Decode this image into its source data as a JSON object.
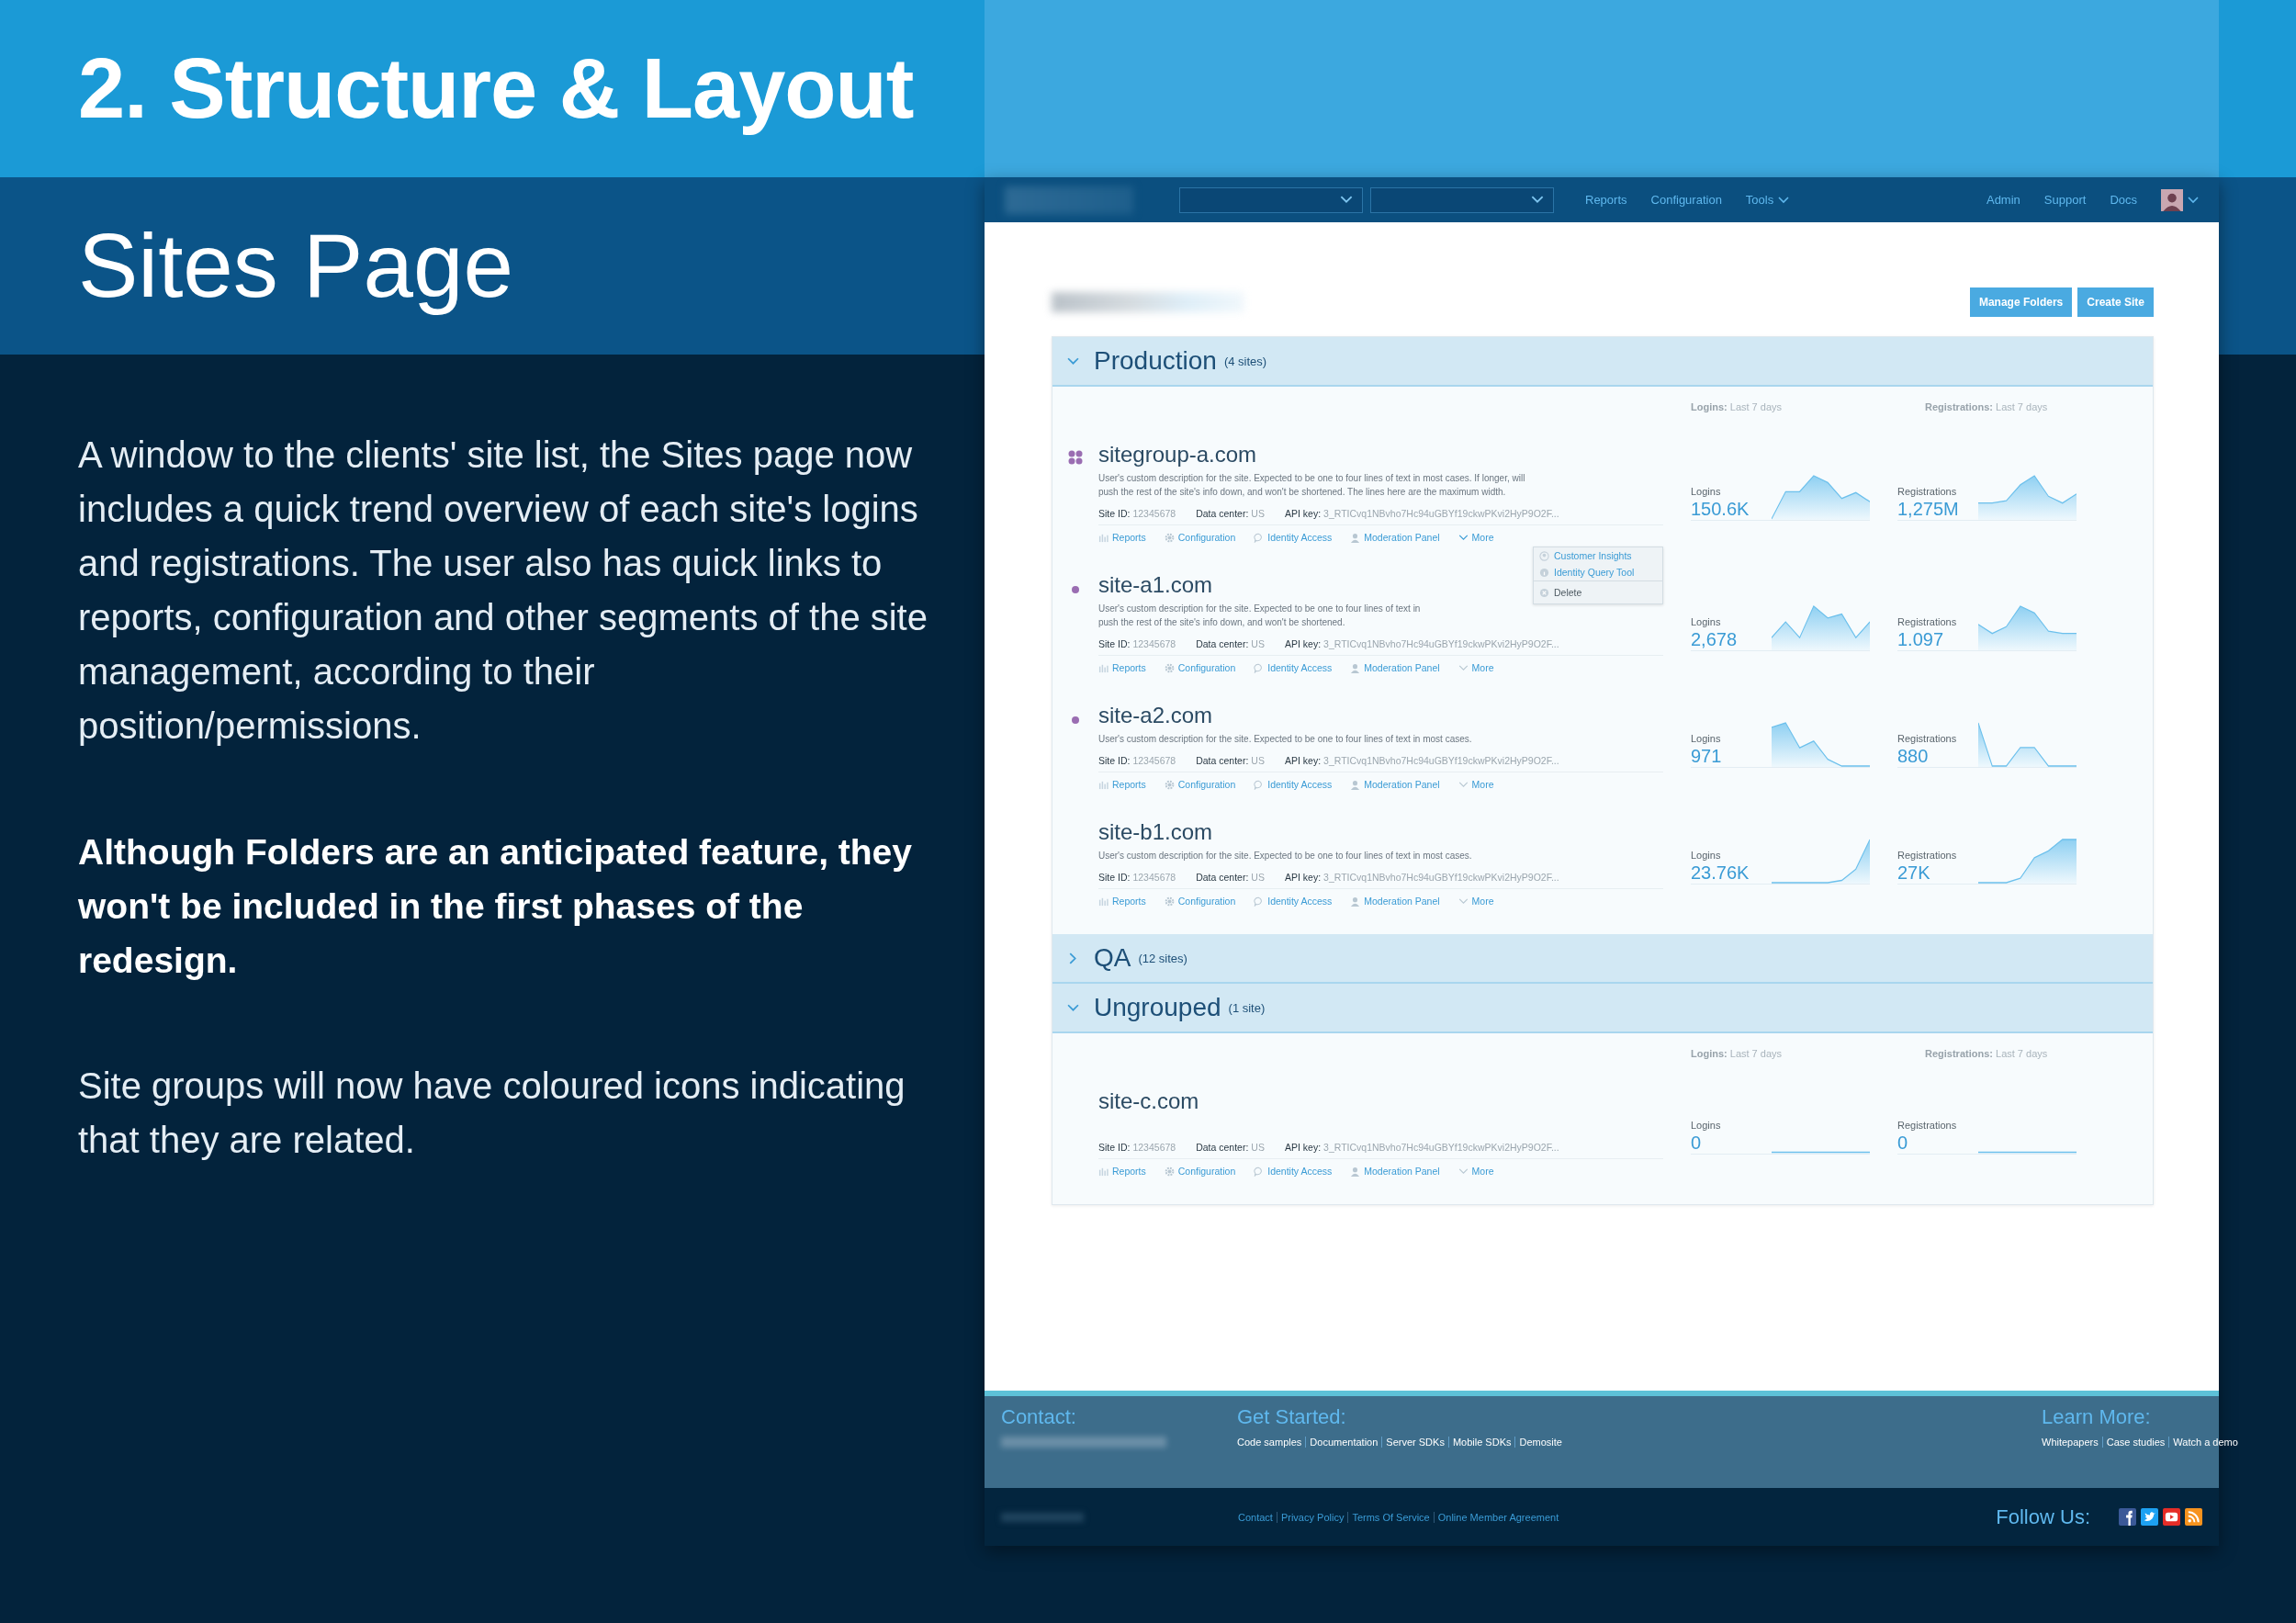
{
  "slide": {
    "title": "2. Structure & Layout",
    "subtitle": "Sites Page",
    "paragraphs": [
      {
        "text": "A window to the clients' site list, the Sites page now includes a quick trend overview of each site's logins and registrations. The user also has quick links to reports, configuration and other segments of the site management, according to their position/permissions.",
        "bold": false
      },
      {
        "text": "Although Folders are an anticipated feature, they won't be included in the first phases of the redesign.",
        "bold": true
      },
      {
        "text": "Site groups will now have coloured icons indicating that they are related.",
        "bold": false
      }
    ]
  },
  "screen": {
    "nav": {
      "links": [
        {
          "label": "Reports",
          "dropdown": false
        },
        {
          "label": "Configuration",
          "dropdown": false
        },
        {
          "label": "Tools",
          "dropdown": true
        }
      ],
      "right_links": [
        "Admin",
        "Support",
        "Docs"
      ]
    },
    "buttons": [
      "Manage Folders",
      "Create Site"
    ],
    "groups": [
      {
        "name": "Production",
        "count": "(4 sites)",
        "expanded": true,
        "metric_headers": [
          "**Logins:** Last 7 days",
          "**Registrations:** Last 7 days"
        ],
        "sites": [
          {
            "name": "sitegroup-a.com",
            "kind": "group",
            "color": "#9a6db2",
            "description_lines": [
              "User's custom description for the site. Expected to be one to four lines of text in most cases. If longer, will",
              "push the rest of the site's info down, and won't be shortened. The lines here are the maximum width."
            ],
            "fields": [
              {
                "label": "Site ID:",
                "value": "12345678"
              },
              {
                "label": "Data center:",
                "value": "US"
              },
              {
                "label": "API key:",
                "value": "3_RTICvq1NBvho7Hc94uGBYf19ckwPKvi2HyP9O2F..."
              }
            ],
            "links": [
              {
                "label": "Reports",
                "kind": "reports"
              },
              {
                "label": "Configuration",
                "kind": "configuration"
              },
              {
                "label": "Identity Access",
                "kind": "identity"
              },
              {
                "label": "Moderation Panel",
                "kind": "moderation"
              },
              {
                "label": "More",
                "kind": "more"
              }
            ],
            "more_menu": [
              {
                "label": "Customer Insights",
                "kind": "insights"
              },
              {
                "label": "Identity Query Tool",
                "kind": "info"
              },
              {
                "label": "Delete",
                "kind": "delete"
              }
            ],
            "metrics": [
              {
                "label": "Logins",
                "value": "150.6K"
              },
              {
                "label": "Registrations",
                "value": "1,275M"
              }
            ]
          },
          {
            "name": "site-a1.com",
            "kind": "member",
            "color": "#9a6db2",
            "description_lines": [
              "User's custom description for the site. Expected to be one to four lines of text in",
              "push the rest of the site's info down, and won't be shortened."
            ],
            "fields": [
              {
                "label": "Site ID:",
                "value": "12345678"
              },
              {
                "label": "Data center:",
                "value": "US"
              },
              {
                "label": "API key:",
                "value": "3_RTICvq1NBvho7Hc94uGBYf19ckwPKvi2HyP9O2F..."
              }
            ],
            "links": [
              {
                "label": "Reports",
                "kind": "reports"
              },
              {
                "label": "Configuration",
                "kind": "configuration"
              },
              {
                "label": "Identity Access",
                "kind": "identity"
              },
              {
                "label": "Moderation Panel",
                "kind": "moderation"
              },
              {
                "label": "More",
                "kind": "more"
              }
            ],
            "metrics": [
              {
                "label": "Logins",
                "value": "2,678"
              },
              {
                "label": "Registrations",
                "value": "1.097"
              }
            ]
          },
          {
            "name": "site-a2.com",
            "kind": "member",
            "color": "#9a6db2",
            "description_lines": [
              "User's custom description for the site. Expected to be one to four lines of text in most cases."
            ],
            "fields": [
              {
                "label": "Site ID:",
                "value": "12345678"
              },
              {
                "label": "Data center:",
                "value": "US"
              },
              {
                "label": "API key:",
                "value": "3_RTICvq1NBvho7Hc94uGBYf19ckwPKvi2HyP9O2F..."
              }
            ],
            "links": [
              {
                "label": "Reports",
                "kind": "reports"
              },
              {
                "label": "Configuration",
                "kind": "configuration"
              },
              {
                "label": "Identity Access",
                "kind": "identity"
              },
              {
                "label": "Moderation Panel",
                "kind": "moderation"
              },
              {
                "label": "More",
                "kind": "more"
              }
            ],
            "metrics": [
              {
                "label": "Logins",
                "value": "971"
              },
              {
                "label": "Registrations",
                "value": "880"
              }
            ]
          },
          {
            "name": "site-b1.com",
            "kind": "plain",
            "description_lines": [
              "User's custom description for the site. Expected to be one to four lines of text in most cases."
            ],
            "fields": [
              {
                "label": "Site ID:",
                "value": "12345678"
              },
              {
                "label": "Data center:",
                "value": "US"
              },
              {
                "label": "API key:",
                "value": "3_RTICvq1NBvho7Hc94uGBYf19ckwPKvi2HyP9O2F..."
              }
            ],
            "links": [
              {
                "label": "Reports",
                "kind": "reports"
              },
              {
                "label": "Configuration",
                "kind": "configuration"
              },
              {
                "label": "Identity Access",
                "kind": "identity"
              },
              {
                "label": "Moderation Panel",
                "kind": "moderation"
              },
              {
                "label": "More",
                "kind": "more"
              }
            ],
            "metrics": [
              {
                "label": "Logins",
                "value": "23.76K"
              },
              {
                "label": "Registrations",
                "value": "27K"
              }
            ]
          }
        ]
      },
      {
        "name": "QA",
        "count": "(12 sites)",
        "expanded": false
      },
      {
        "name": "Ungrouped",
        "count": "(1 site)",
        "expanded": true,
        "metric_headers": [
          "**Logins:** Last 7 days",
          "**Registrations:** Last 7 days"
        ],
        "sites": [
          {
            "name": "site-c.com",
            "kind": "plain",
            "fields": [
              {
                "label": "Site ID:",
                "value": "12345678"
              },
              {
                "label": "Data center:",
                "value": "US"
              },
              {
                "label": "API key:",
                "value": "3_RTICvq1NBvho7Hc94uGBYf19ckwPKvi2HyP9O2F..."
              }
            ],
            "links": [
              {
                "label": "Reports",
                "kind": "reports"
              },
              {
                "label": "Configuration",
                "kind": "configuration"
              },
              {
                "label": "Identity Access",
                "kind": "identity"
              },
              {
                "label": "Moderation Panel",
                "kind": "moderation"
              },
              {
                "label": "More",
                "kind": "more"
              }
            ],
            "metrics": [
              {
                "label": "Logins",
                "value": "0"
              },
              {
                "label": "Registrations",
                "value": "0"
              }
            ]
          }
        ]
      }
    ],
    "footer": {
      "columns": [
        {
          "heading": "Contact:"
        },
        {
          "heading": "Get Started:",
          "links": [
            "Code samples",
            "Documentation",
            "Server SDKs",
            "Mobile SDKs",
            "Demosite"
          ]
        },
        {
          "heading": "Learn More:",
          "links": [
            "Whitepapers",
            "Case studies",
            "Watch a demo"
          ]
        }
      ],
      "bottom_links": [
        "Contact",
        "Privacy Policy",
        "Terms Of Service",
        "Online Member Agreement"
      ],
      "follow": "Follow Us:"
    }
  }
}
